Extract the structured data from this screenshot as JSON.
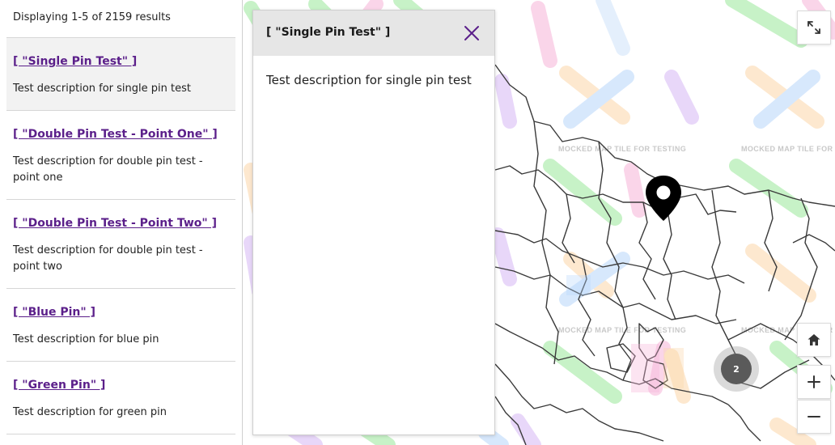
{
  "results": {
    "count_text": "Displaying 1-5 of 2159 results",
    "items": [
      {
        "title": "[ \"Single Pin Test\" ]",
        "description": "Test description for single pin test"
      },
      {
        "title": "[ \"Double Pin Test - Point One\" ]",
        "description": "Test description for double pin test - point one"
      },
      {
        "title": "[ \"Double Pin Test - Point Two\" ]",
        "description": "Test description for double pin test - point two"
      },
      {
        "title": "[ \"Blue Pin\" ]",
        "description": "Test description for blue pin"
      },
      {
        "title": "[ \"Green Pin\" ]",
        "description": "Test description for green pin"
      }
    ]
  },
  "popup": {
    "title": "[ \"Single Pin Test\" ]",
    "body": "Test description for single pin test",
    "close_icon": "close-icon"
  },
  "map": {
    "tile_label": "MOCKED MAP TILE FOR TESTING",
    "cluster_count": "2",
    "controls": {
      "fullscreen_icon": "fullscreen-icon",
      "home_icon": "home-icon",
      "zoom_in_icon": "plus-icon",
      "zoom_out_icon": "minus-icon"
    }
  },
  "colors": {
    "link": "#5b1f8a",
    "close_icon": "#5b1f8a",
    "cluster": "#5a5a5a",
    "active_row": "#f2f2f2"
  }
}
